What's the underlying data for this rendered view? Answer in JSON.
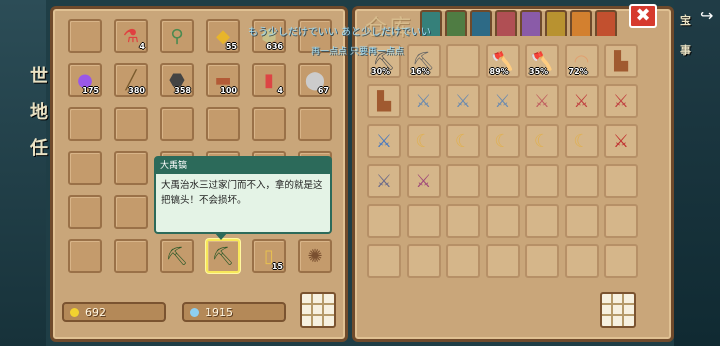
{
  "background": {
    "side_chars": [
      "地",
      "任",
      "世"
    ],
    "right_chars": [
      "宝",
      "事"
    ]
  },
  "header": {
    "storage_title": "仓库",
    "subtitle_line1": "もう少しだけでいい あと少しだけでいい",
    "subtitle_line2": "再一点点 只要再一点点",
    "close_label": "✖",
    "tab_colors": [
      "#35807a",
      "#4f7c43",
      "#2d6a86",
      "#b04f54",
      "#8a5ba8",
      "#b89230",
      "#d3802f",
      "#c2502f"
    ]
  },
  "bag": {
    "slots": [
      {
        "icon": "",
        "count": ""
      },
      {
        "icon": "⚗",
        "count": "4",
        "color": "#e04040"
      },
      {
        "icon": "⚲",
        "count": "",
        "color": "#4a8a50"
      },
      {
        "icon": "◆",
        "count": "55",
        "color": "#e8b52a"
      },
      {
        "icon": "⬢",
        "count": "636",
        "color": "#c8c08a"
      },
      {
        "icon": "",
        "count": ""
      },
      {
        "icon": "●",
        "count": "175",
        "color": "#9a58e8"
      },
      {
        "icon": "╱",
        "count": "380",
        "color": "#7a5b2e"
      },
      {
        "icon": "⬣",
        "count": "358",
        "color": "#444"
      },
      {
        "icon": "▬",
        "count": "100",
        "color": "#b35a36"
      },
      {
        "icon": "▮",
        "count": "4",
        "color": "#d44"
      },
      {
        "icon": "⬤",
        "count": "67",
        "color": "#ccc"
      },
      {
        "icon": "",
        "count": ""
      },
      {
        "icon": "",
        "count": ""
      },
      {
        "icon": "",
        "count": ""
      },
      {
        "icon": "",
        "count": ""
      },
      {
        "icon": "",
        "count": ""
      },
      {
        "icon": "",
        "count": ""
      },
      {
        "icon": "",
        "count": ""
      },
      {
        "icon": "",
        "count": ""
      },
      {
        "icon": "",
        "count": ""
      },
      {
        "icon": "",
        "count": ""
      },
      {
        "icon": "",
        "count": ""
      },
      {
        "icon": "",
        "count": ""
      },
      {
        "icon": "",
        "count": ""
      },
      {
        "icon": "",
        "count": ""
      },
      {
        "icon": "",
        "count": ""
      },
      {
        "icon": "",
        "count": ""
      },
      {
        "icon": "",
        "count": ""
      },
      {
        "icon": "",
        "count": ""
      },
      {
        "icon": "",
        "count": ""
      },
      {
        "icon": "",
        "count": ""
      },
      {
        "icon": "⛏",
        "count": "",
        "color": "#2f5a2a"
      },
      {
        "icon": "⛏",
        "count": "",
        "color": "#2f5a2a"
      },
      {
        "icon": "▯",
        "count": "15",
        "color": "#e8c050"
      },
      {
        "icon": "✺",
        "count": "",
        "color": "#7a5030"
      }
    ],
    "selected_index": 33
  },
  "storage": {
    "slots": [
      {
        "icon": "⛏",
        "count": "30%",
        "color": "#555"
      },
      {
        "icon": "⛏",
        "count": "16%",
        "color": "#666"
      },
      {
        "icon": "",
        "count": ""
      },
      {
        "icon": "🪓",
        "count": "89%",
        "color": "#777"
      },
      {
        "icon": "🪓",
        "count": "35%",
        "color": "#b04a3a"
      },
      {
        "icon": "◠",
        "count": "72%",
        "color": "#e0a070"
      },
      {
        "icon": "▙",
        "count": "",
        "color": "#a05a30"
      },
      {
        "icon": "▙",
        "count": "",
        "color": "#a05a30"
      },
      {
        "icon": "⚔",
        "count": "",
        "color": "#6a8ab0"
      },
      {
        "icon": "⚔",
        "count": "",
        "color": "#6a8ab0"
      },
      {
        "icon": "⚔",
        "count": "",
        "color": "#6a8ab0"
      },
      {
        "icon": "⚔",
        "count": "",
        "color": "#c06060"
      },
      {
        "icon": "⚔",
        "count": "",
        "color": "#c04040"
      },
      {
        "icon": "⚔",
        "count": "",
        "color": "#c04040"
      },
      {
        "icon": "⚔",
        "count": "",
        "color": "#4a7ac0"
      },
      {
        "icon": "☾",
        "count": "",
        "color": "#e0b050"
      },
      {
        "icon": "☾",
        "count": "",
        "color": "#e0b050"
      },
      {
        "icon": "☾",
        "count": "",
        "color": "#e0b050"
      },
      {
        "icon": "☾",
        "count": "",
        "color": "#e0b050"
      },
      {
        "icon": "☾",
        "count": "",
        "color": "#e0b050"
      },
      {
        "icon": "⚔",
        "count": "",
        "color": "#c03030"
      },
      {
        "icon": "⚔",
        "count": "",
        "color": "#6a6a8a"
      },
      {
        "icon": "⚔",
        "count": "",
        "color": "#a04a7a"
      },
      {
        "icon": "",
        "count": ""
      },
      {
        "icon": "",
        "count": ""
      },
      {
        "icon": "",
        "count": ""
      },
      {
        "icon": "",
        "count": ""
      },
      {
        "icon": "",
        "count": ""
      },
      {
        "icon": "",
        "count": ""
      },
      {
        "icon": "",
        "count": ""
      },
      {
        "icon": "",
        "count": ""
      },
      {
        "icon": "",
        "count": ""
      },
      {
        "icon": "",
        "count": ""
      },
      {
        "icon": "",
        "count": ""
      },
      {
        "icon": "",
        "count": ""
      },
      {
        "icon": "",
        "count": ""
      },
      {
        "icon": "",
        "count": ""
      },
      {
        "icon": "",
        "count": ""
      },
      {
        "icon": "",
        "count": ""
      },
      {
        "icon": "",
        "count": ""
      },
      {
        "icon": "",
        "count": ""
      },
      {
        "icon": "",
        "count": ""
      }
    ]
  },
  "currency": {
    "gold": "692",
    "gems": "1915",
    "gold_color": "#f2d230",
    "gem_color": "#8ecff0"
  },
  "tooltip": {
    "title": "大禹镐",
    "body": "大禹治水三过家门而不入，拿的就是这把镐头！不会损坏。"
  },
  "nav": {
    "back_icon": "↪"
  }
}
